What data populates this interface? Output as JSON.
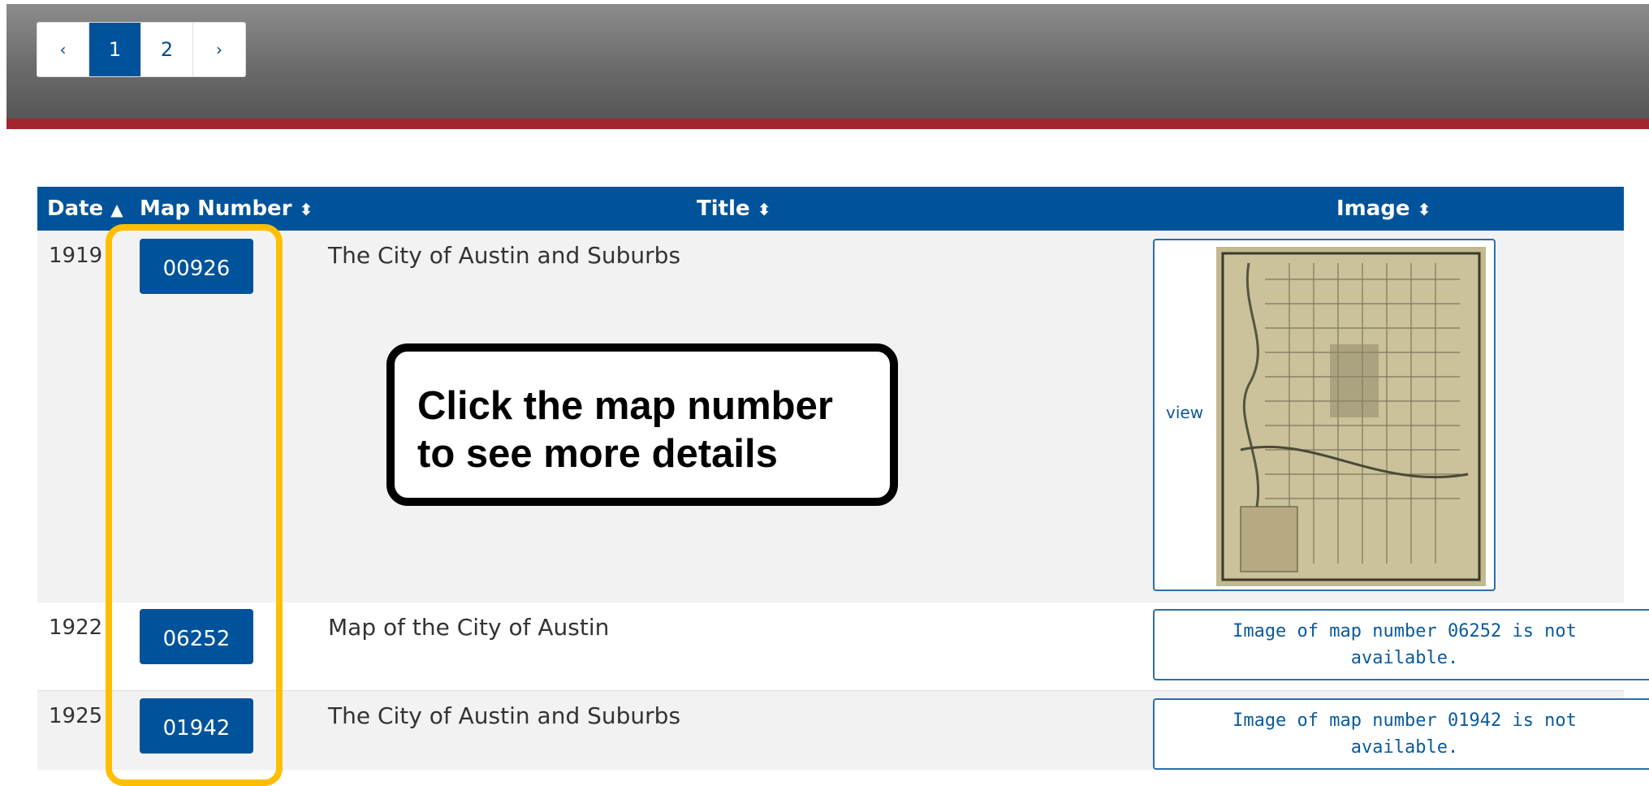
{
  "pagination": {
    "prev": "‹",
    "pages": [
      "1",
      "2"
    ],
    "current": "1",
    "next": "›"
  },
  "table": {
    "columns": [
      {
        "label": "Date",
        "sort_icon": "▲"
      },
      {
        "label": "Map Number",
        "sort_icon": "⬍"
      },
      {
        "label": "Title",
        "sort_icon": "⬍"
      },
      {
        "label": "Image",
        "sort_icon": "⬍"
      }
    ],
    "rows": [
      {
        "date": "1919",
        "map_number": "00926",
        "title": "The City of Austin and Suburbs",
        "image_link": "view"
      },
      {
        "date": "1922",
        "map_number": "06252",
        "title": "Map of the City of Austin",
        "image_note": "Image of map number 06252 is not available."
      },
      {
        "date": "1925",
        "map_number": "01942",
        "title": "The City of Austin and Suburbs",
        "image_note": "Image of map number 01942 is not available."
      }
    ]
  },
  "callout": {
    "line1": "Click the map number",
    "line2": "to see more details"
  },
  "colors": {
    "header_blue": "#00539b",
    "accent_red": "#a3262f",
    "highlight": "#ffbf00"
  }
}
